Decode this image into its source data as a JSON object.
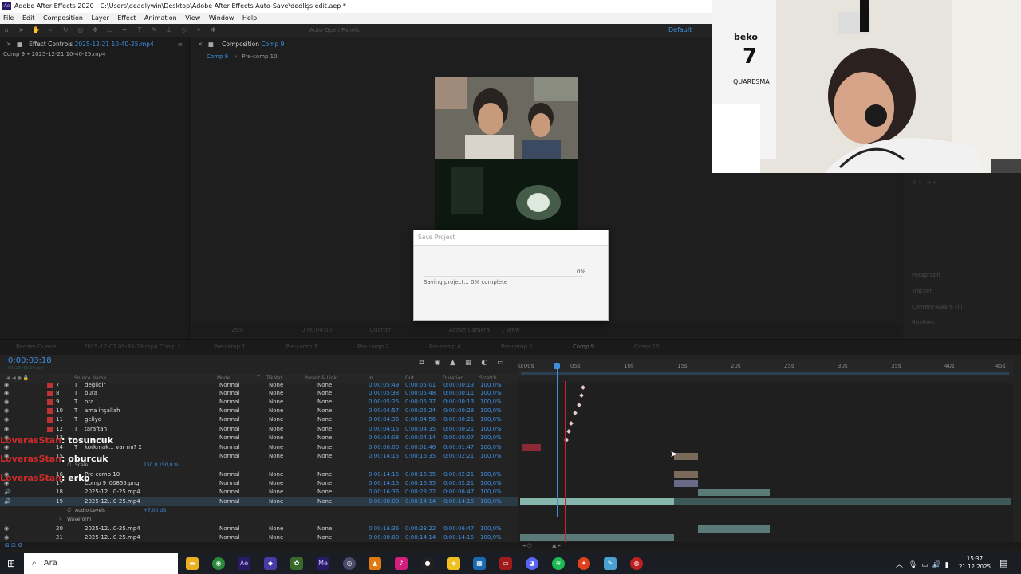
{
  "window": {
    "title": "Adobe After Effects 2020 - C:\\Users\\deadlywin\\Desktop\\Adobe After Effects Auto-Save\\dedlişs edit.aep *",
    "menu": [
      "File",
      "Edit",
      "Composition",
      "Layer",
      "Effect",
      "Animation",
      "View",
      "Window",
      "Help"
    ]
  },
  "toolbar": {
    "auto_open": "Auto-Open Panels",
    "workspace": "Default"
  },
  "effect_controls": {
    "tab_label": "Effect Controls",
    "tab_file": "2025-12-21 10-40-25.mp4",
    "breadcrumb": "Comp 9 • 2025-12-21 10-40-25.mp4"
  },
  "composition": {
    "tab_label": "Composition",
    "tab_comp": "Comp 9",
    "nav": [
      "Comp 9",
      "Pre-comp 10"
    ],
    "viewer_zoom": "25%",
    "viewer_time": "0:00:04:00",
    "viewer_quality": "Quarter",
    "viewer_camera": "Active Camera",
    "viewer_view": "1 View"
  },
  "save_dialog": {
    "title": "Save Project",
    "percent": "0%",
    "progress": 0,
    "message": "Saving project... 0% complete"
  },
  "right_panels": [
    "Paragraph",
    "Tracker",
    "Content-Aware Fill",
    "Brushes"
  ],
  "timeline": {
    "tabs": [
      "Render Queue",
      "2025-12-07 09-35-19.mp4 Comp 1",
      "Pre-comp 1",
      "Pre-comp 3",
      "Pre-comp 2",
      "Pre-comp 4",
      "Pre-comp 5",
      "Comp 9",
      "Comp 10"
    ],
    "timecode": "0:00:03:18",
    "fps": "00113 (60.00 fps)",
    "columns": {
      "source": "Source Name",
      "mode": "Mode",
      "t": "T",
      "trkmat": "TrkMat",
      "parent": "Parent & Link",
      "in": "In",
      "out": "Out",
      "duration": "Duration",
      "stretch": "Stretch"
    },
    "ruler": [
      "0:00s",
      "05s",
      "10s",
      "15s",
      "20s",
      "25s",
      "30s",
      "35s",
      "40s",
      "45s"
    ],
    "layers": [
      {
        "num": "7",
        "type": "T",
        "name": "değildir",
        "mode": "Normal",
        "trk": "None",
        "parent": "None",
        "in": "0:00:05:49",
        "out": "0:00:05:01",
        "dur": "0:00:00:13",
        "str": "100,0%"
      },
      {
        "num": "8",
        "type": "T",
        "name": "bura",
        "mode": "Normal",
        "trk": "None",
        "parent": "None",
        "in": "0:00:05:38",
        "out": "0:00:05:48",
        "dur": "0:00:00:11",
        "str": "100,0%"
      },
      {
        "num": "9",
        "type": "T",
        "name": "ora",
        "mode": "Normal",
        "trk": "None",
        "parent": "None",
        "in": "0:00:05:25",
        "out": "0:00:05:37",
        "dur": "0:00:00:13",
        "str": "100,0%"
      },
      {
        "num": "10",
        "type": "T",
        "name": "ama inşallah",
        "mode": "Normal",
        "trk": "None",
        "parent": "None",
        "in": "0:00:04:57",
        "out": "0:00:05:24",
        "dur": "0:00:00:28",
        "str": "100,0%"
      },
      {
        "num": "11",
        "type": "T",
        "name": "geliyo",
        "mode": "Normal",
        "trk": "None",
        "parent": "None",
        "in": "0:00:04:36",
        "out": "0:00:04:56",
        "dur": "0:00:00:21",
        "str": "100,0%"
      },
      {
        "num": "12",
        "type": "T",
        "name": "taraftan",
        "mode": "Normal",
        "trk": "None",
        "parent": "None",
        "in": "0:00:04:15",
        "out": "0:00:04:35",
        "dur": "0:00:00:21",
        "str": "100,0%"
      },
      {
        "num": "13",
        "type": "T",
        "name": "",
        "mode": "Normal",
        "trk": "None",
        "parent": "None",
        "in": "0:00:04:08",
        "out": "0:00:04:14",
        "dur": "0:00:00:07",
        "str": "100,0%"
      },
      {
        "num": "14",
        "type": "T",
        "name": "korkmak... var mı? 2",
        "mode": "Normal",
        "trk": "None",
        "parent": "None",
        "in": "0:00:00:00",
        "out": "0:00:01:46",
        "dur": "0:00:01:47",
        "str": "100,0%"
      },
      {
        "num": "15",
        "type": "",
        "name": "",
        "mode": "Normal",
        "trk": "None",
        "parent": "None",
        "in": "0:00:14:15",
        "out": "0:00:16:35",
        "dur": "0:00:02:21",
        "str": "100,0%"
      },
      {
        "num": "16",
        "type": "",
        "name": "Pre-comp 10",
        "mode": "Normal",
        "trk": "None",
        "parent": "None",
        "in": "0:00:14:15",
        "out": "0:00:16:35",
        "dur": "0:00:02:21",
        "str": "100,0%"
      },
      {
        "num": "17",
        "type": "",
        "name": "Comp 9_00855.png",
        "mode": "Normal",
        "trk": "None",
        "parent": "None",
        "in": "0:00:14:15",
        "out": "0:00:16:35",
        "dur": "0:00:02:21",
        "str": "100,0%"
      },
      {
        "num": "18",
        "type": "",
        "name": "2025-12...0-25.mp4",
        "mode": "Normal",
        "trk": "None",
        "parent": "None",
        "in": "0:00:16:36",
        "out": "0:00:23:22",
        "dur": "0:00:06:47",
        "str": "100,0%"
      },
      {
        "num": "19",
        "type": "",
        "name": "2025-12...0-25.mp4",
        "mode": "Normal",
        "trk": "None",
        "parent": "None",
        "in": "0:00:00:00",
        "out": "0:00:14:14",
        "dur": "0:00:14:15",
        "str": "100,0%"
      },
      {
        "num": "20",
        "type": "",
        "name": "2025-12...0-25.mp4",
        "mode": "Normal",
        "trk": "None",
        "parent": "None",
        "in": "0:00:16:36",
        "out": "0:00:23:22",
        "dur": "0:00:06:47",
        "str": "100,0%"
      },
      {
        "num": "21",
        "type": "",
        "name": "2025-12...0-25.mp4",
        "mode": "Normal",
        "trk": "None",
        "parent": "None",
        "in": "0:00:00:00",
        "out": "0:00:14:14",
        "dur": "0:00:14:15",
        "str": "100,0%"
      }
    ],
    "sub_scale": {
      "label": "Scale",
      "value": "150,0,150,0 %"
    },
    "sub_audio": {
      "label": "Audio Levels",
      "value": "+7,00 dB"
    },
    "sub_waveform": "Waveform",
    "chat": [
      {
        "user": "LoverasStan",
        "msg": ": tosuncuk"
      },
      {
        "user": "LoverasStan",
        "msg": ": oburcuk"
      },
      {
        "user": "LoverasStan",
        "msg": ": erko"
      }
    ]
  },
  "webcam": {
    "jersey_brand": "beko",
    "jersey_number": "7",
    "jersey_name": "QUARESMA"
  },
  "taskbar": {
    "search": "Ara",
    "apps": [
      "file-explorer-icon",
      "chrome-icon",
      "after-effects-icon",
      "shield-icon",
      "app-icon",
      "media-encoder-icon",
      "obs-icon",
      "vlc-icon",
      "capcut-icon",
      "chat-icon",
      "maps-icon",
      "photos-icon",
      "media-icon",
      "discord-icon",
      "spotify-icon",
      "fire-icon",
      "notepad-icon",
      "headset-icon"
    ],
    "time": "15:37",
    "date": "21.12.2025"
  },
  "colors": {
    "accent": "#3d8fe0",
    "playhead": "#3d8fe0",
    "cti_red": "#cc2233",
    "chat_user": "#d42b2b"
  }
}
